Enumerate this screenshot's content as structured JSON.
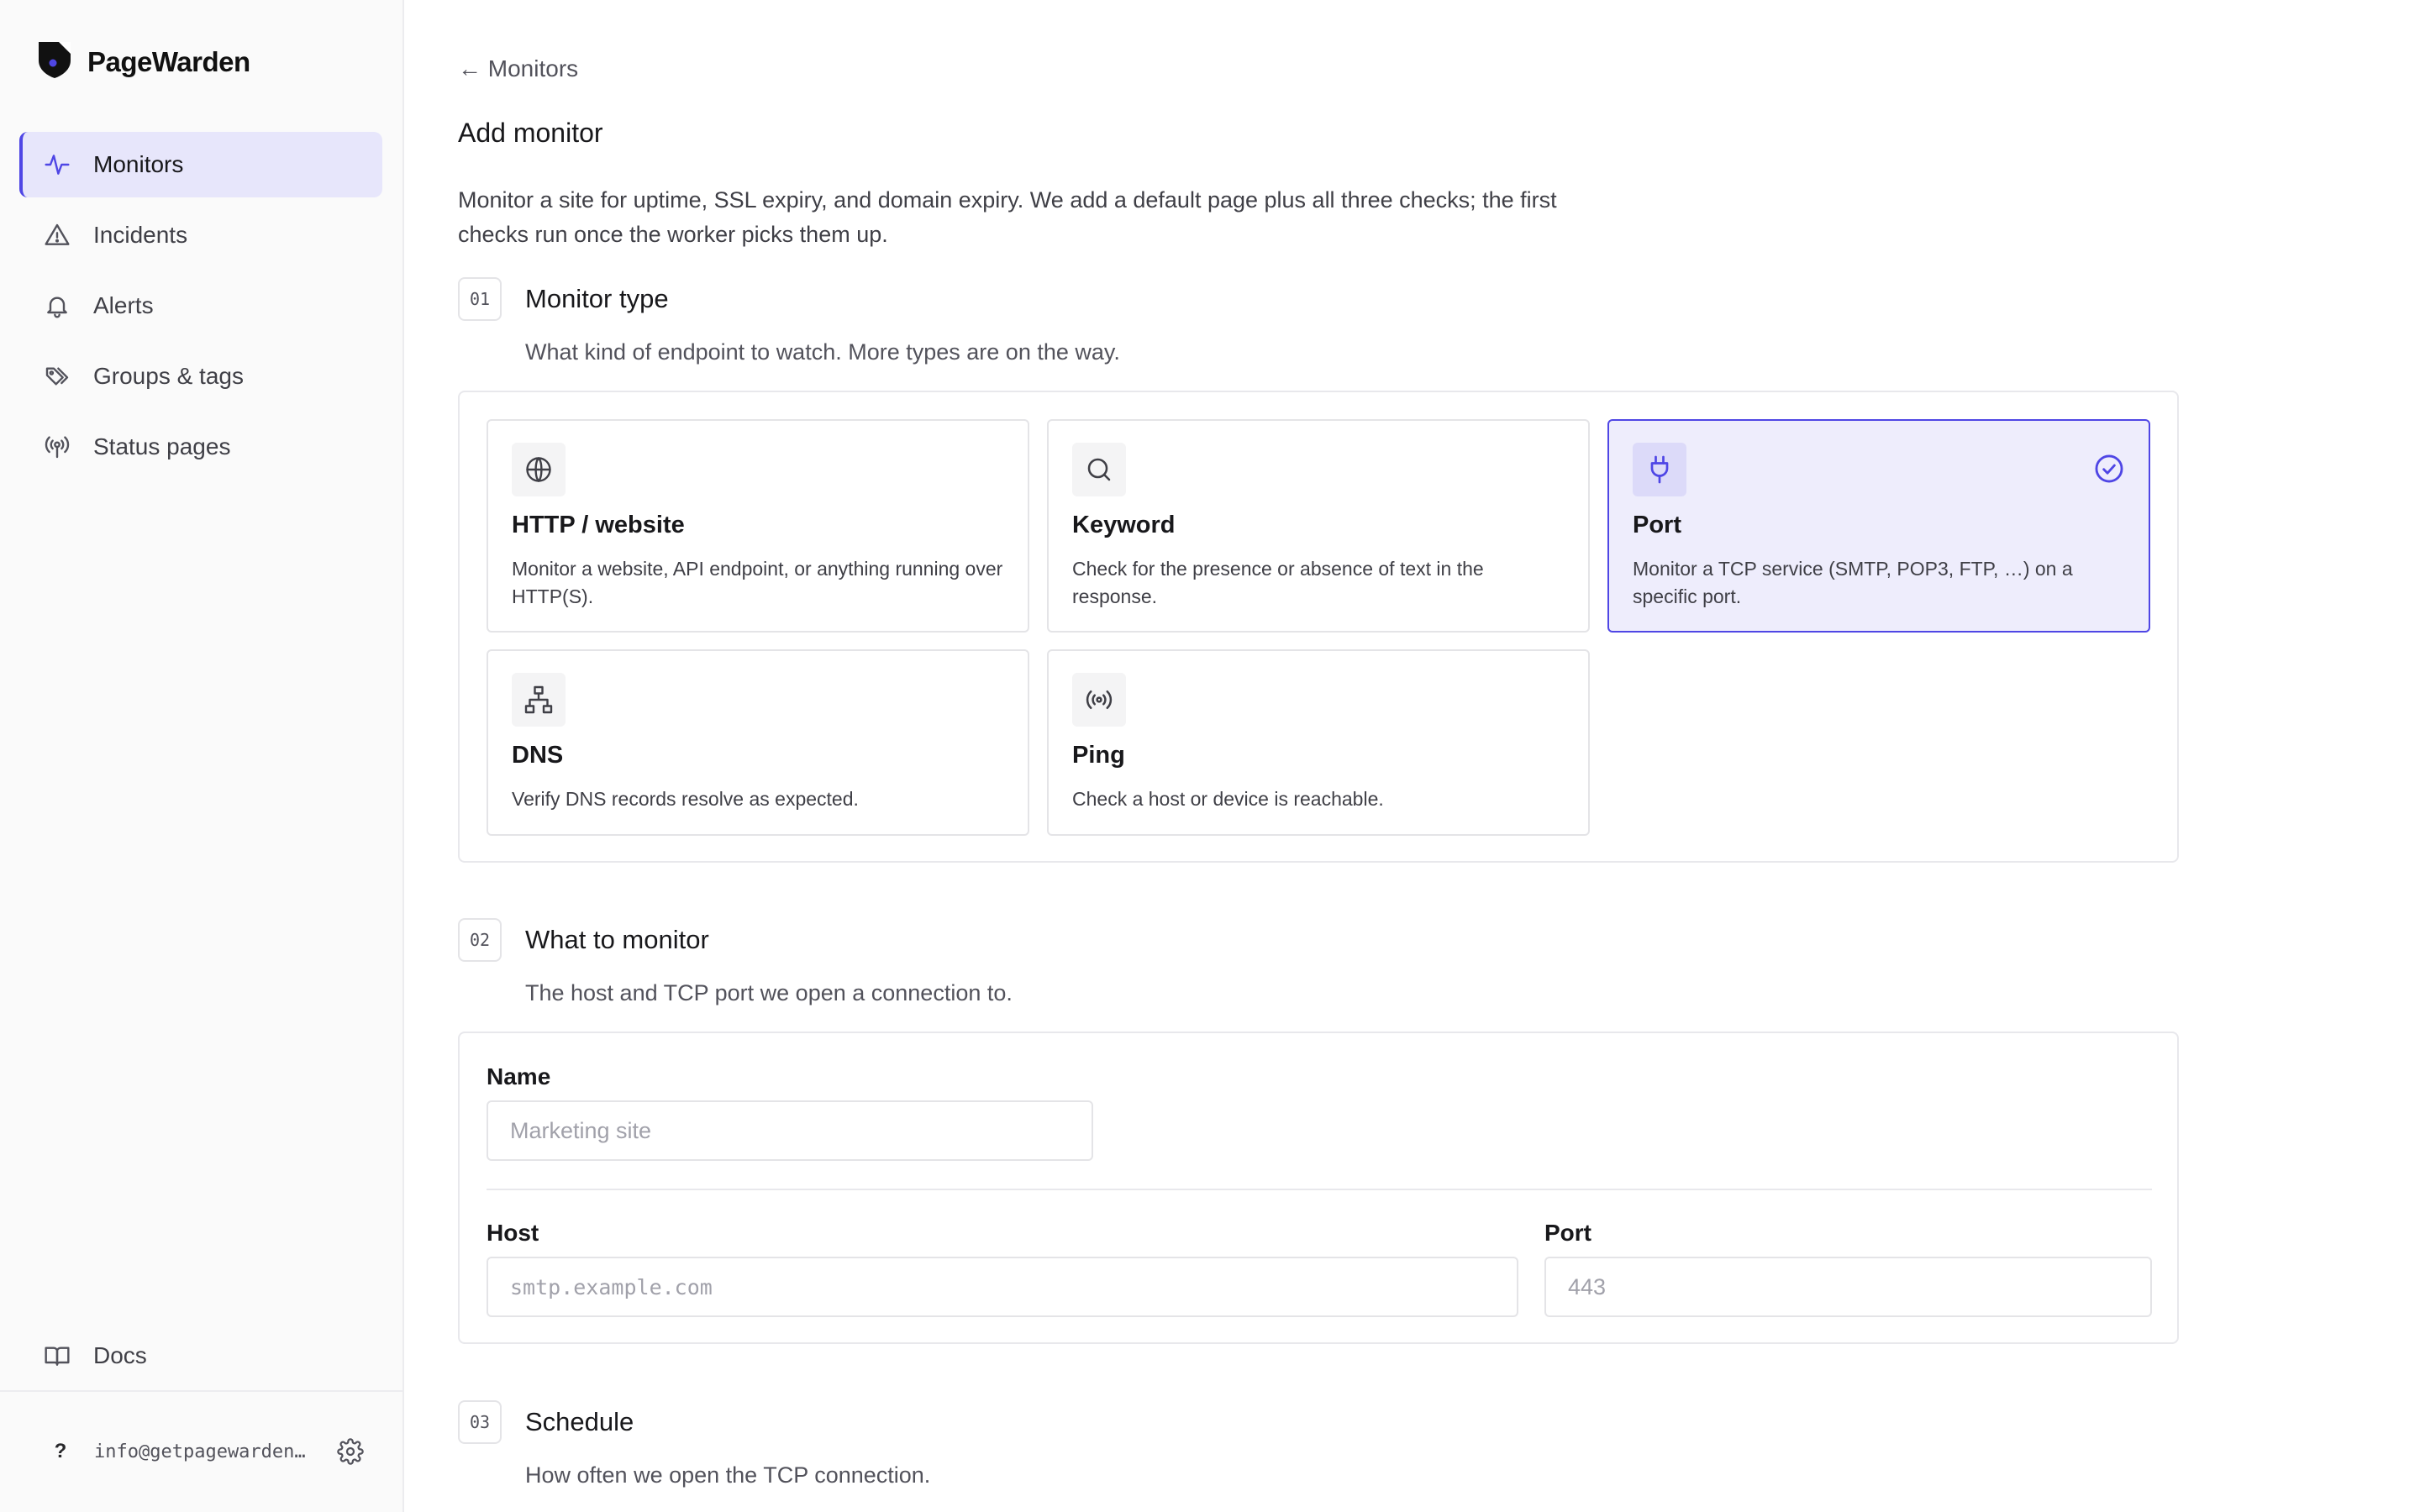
{
  "app": {
    "brand": "PageWarden"
  },
  "sidebar": {
    "items": [
      {
        "label": "Monitors",
        "icon": "activity-icon",
        "active": true
      },
      {
        "label": "Incidents",
        "icon": "warning-triangle-icon"
      },
      {
        "label": "Alerts",
        "icon": "bell-icon"
      },
      {
        "label": "Groups & tags",
        "icon": "tags-icon"
      },
      {
        "label": "Status pages",
        "icon": "broadcast-icon"
      }
    ],
    "docs_label": "Docs",
    "user": {
      "help": "?",
      "email": "info@getpagewarden…"
    }
  },
  "main": {
    "back_label": "← Monitors",
    "title": "Add monitor",
    "intro": "Monitor a site for uptime, SSL expiry, and domain expiry. We add a default page plus all three checks; the first checks run once the worker picks them up.",
    "steps": [
      {
        "num": "01",
        "title": "Monitor type",
        "subtitle": "What kind of endpoint to watch. More types are on the way."
      },
      {
        "num": "02",
        "title": "What to monitor",
        "subtitle": "The host and TCP port we open a connection to."
      },
      {
        "num": "03",
        "title": "Schedule",
        "subtitle": "How often we open the TCP connection."
      }
    ],
    "types": [
      {
        "title": "HTTP / website",
        "desc": "Monitor a website, API endpoint, or anything running over HTTP(S).",
        "icon": "globe-icon"
      },
      {
        "title": "Keyword",
        "desc": "Check for the presence or absence of text in the response.",
        "icon": "search-icon"
      },
      {
        "title": "Port",
        "desc": "Monitor a TCP service (SMTP, POP3, FTP, …) on a specific port.",
        "icon": "plug-icon",
        "selected": true
      },
      {
        "title": "DNS",
        "desc": "Verify DNS records resolve as expected.",
        "icon": "network-icon"
      },
      {
        "title": "Ping",
        "desc": "Check a host or device is reachable.",
        "icon": "radio-signal-icon"
      }
    ],
    "form": {
      "name_label": "Name",
      "name_placeholder": "Marketing site",
      "host_label": "Host",
      "host_placeholder": "smtp.example.com",
      "port_label": "Port",
      "port_placeholder": "443"
    }
  },
  "colors": {
    "accent": "#4f46e5",
    "accent_bg": "#eeedfc",
    "sidebar_active_bg": "#e7e6fb"
  }
}
